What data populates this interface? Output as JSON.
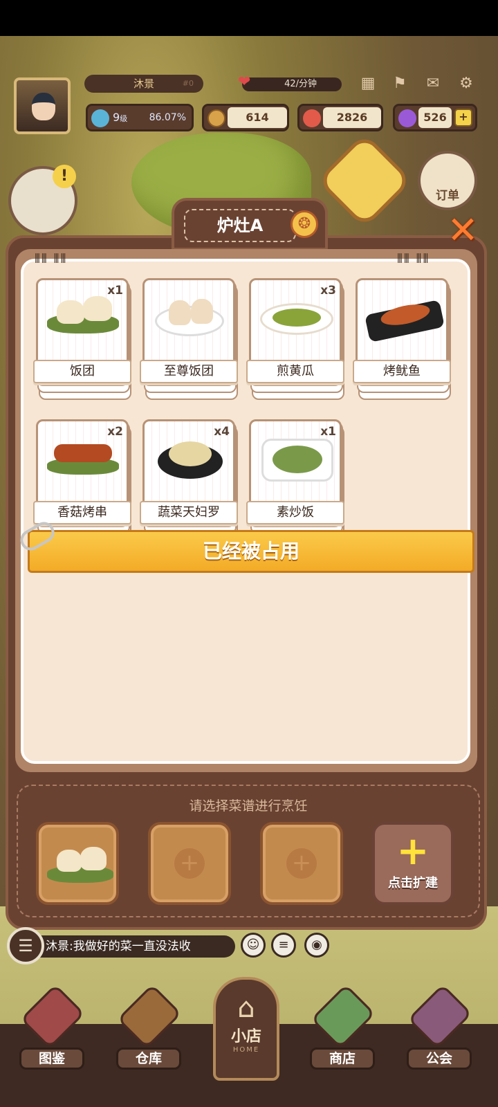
{
  "player": {
    "name": "沐景",
    "rank": "#0",
    "level": "9",
    "level_suffix": "级",
    "exp": "86.07%"
  },
  "rate": {
    "value": "42/分钟"
  },
  "resources": {
    "coins": "614",
    "hearts": "2826",
    "gems": "526"
  },
  "icons": {
    "calendar": "calendar-icon",
    "broom": "broom-icon",
    "mail": "mail-icon",
    "settings": "gear-icon"
  },
  "order_button": "订单",
  "bag_alert": "!",
  "panel": {
    "title": "炉灶A",
    "close": "✕",
    "recipes": [
      {
        "name": "饭团",
        "qty": "x1"
      },
      {
        "name": "至尊饭团",
        "qty": ""
      },
      {
        "name": "煎黄瓜",
        "qty": "x3"
      },
      {
        "name": "烤鱿鱼",
        "qty": ""
      },
      {
        "name": "香菇烤串",
        "qty": "x2"
      },
      {
        "name": "蔬菜天妇罗",
        "qty": "x4"
      },
      {
        "name": "素炒饭",
        "qty": "x1"
      }
    ],
    "occupied_text": "已经被占用",
    "slots_hint": "请选择菜谱进行烹饪",
    "expand_label": "点击扩建"
  },
  "chat": {
    "message": "沐景:我做好的菜一直没法收"
  },
  "nav": {
    "catalog": "图鉴",
    "warehouse": "仓库",
    "home": "小店",
    "home_sub": "HOME",
    "shop": "商店",
    "guild": "公会"
  }
}
